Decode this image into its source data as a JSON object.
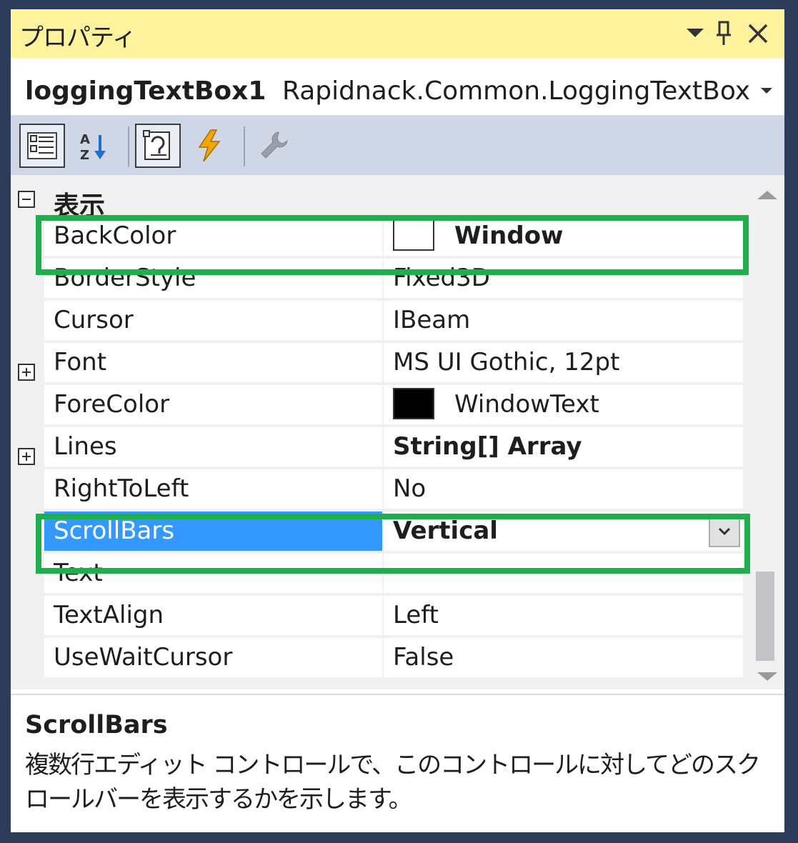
{
  "title": "プロパティ",
  "title_icons": [
    "dropdown-icon",
    "pin-icon",
    "close-icon"
  ],
  "selector": {
    "object_name": "loggingTextBox1",
    "object_type": "Rapidnack.Common.LoggingTextBox"
  },
  "toolbar": {
    "buttons": [
      {
        "name": "categorized-icon",
        "checked": true
      },
      {
        "name": "alphabetical-icon",
        "checked": false
      },
      {
        "name": "properties-icon",
        "checked": true
      },
      {
        "name": "events-icon",
        "checked": false
      },
      {
        "name": "property-pages-icon",
        "checked": false
      }
    ]
  },
  "grid": {
    "category": "表示",
    "rows": [
      {
        "name": "BackColor",
        "value": "Window",
        "bold": true,
        "swatch": "#ffffff",
        "expandable": false,
        "highlighted": true
      },
      {
        "name": "BorderStyle",
        "value": "Fixed3D",
        "bold": false
      },
      {
        "name": "Cursor",
        "value": "IBeam",
        "bold": false
      },
      {
        "name": "Font",
        "value": "MS UI Gothic, 12pt",
        "bold": false,
        "expandable": true
      },
      {
        "name": "ForeColor",
        "value": "WindowText",
        "bold": false,
        "swatch": "#000000"
      },
      {
        "name": "Lines",
        "value": "String[] Array",
        "bold": true,
        "expandable": true
      },
      {
        "name": "RightToLeft",
        "value": "No",
        "bold": false
      },
      {
        "name": "ScrollBars",
        "value": "Vertical",
        "bold": true,
        "selected": true,
        "dropdown": true,
        "highlighted": true
      },
      {
        "name": "Text",
        "value": "",
        "bold": false
      },
      {
        "name": "TextAlign",
        "value": "Left",
        "bold": false
      },
      {
        "name": "UseWaitCursor",
        "value": "False",
        "bold": false
      }
    ]
  },
  "description": {
    "title": "ScrollBars",
    "body": "複数行エディット コントロールで、このコントロールに対してどのスクロールバーを表示するかを示します。"
  },
  "colors": {
    "title_bar": "#fff29d",
    "toolbar": "#cfd6e5",
    "selection": "#3399ff",
    "highlight": "#1fad4e",
    "frame": "#2d3c59"
  }
}
